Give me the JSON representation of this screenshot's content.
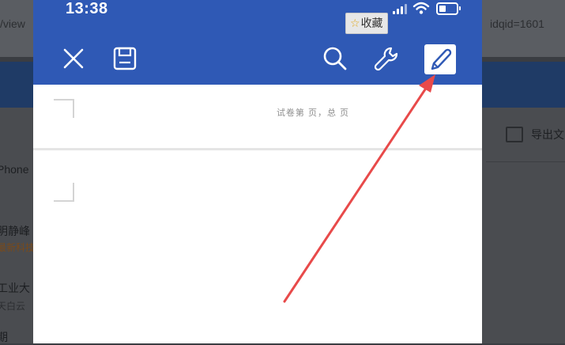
{
  "background": {
    "url_left": "/view",
    "url_right": "idqid=1601",
    "side_items": [
      {
        "main": "Phone",
        "sub": ""
      },
      {
        "main": "明静峰",
        "sub": "最新科技"
      },
      {
        "main": "工业大",
        "sub": "天白云"
      },
      {
        "main": "期",
        "sub": ""
      }
    ],
    "export_label": "导出文"
  },
  "status_bar": {
    "time": "13:38"
  },
  "favorite_badge": {
    "label": "收藏",
    "icon": "star-icon"
  },
  "toolbar": {
    "close_icon": "close-icon",
    "save_icon": "save-icon",
    "search_icon": "search-icon",
    "tools_icon": "wrench-icon",
    "edit_icon": "pencil-icon"
  },
  "document": {
    "header_text": "试卷第 页，总 页"
  },
  "colors": {
    "appbar": "#2f59b5",
    "arrow": "#e84a4a"
  }
}
